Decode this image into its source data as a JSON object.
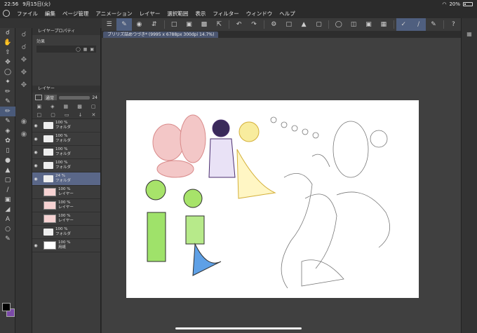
{
  "status": {
    "time": "22:56",
    "date": "9月15日(火)",
    "battery": "20%"
  },
  "menu": [
    "ファイル",
    "編集",
    "ページ管理",
    "アニメーション",
    "レイヤー",
    "選択範囲",
    "表示",
    "フィルター",
    "ウィンドウ",
    "ヘルプ"
  ],
  "tab": {
    "label": "プリリズ詰めつづき* (9995 x 6788px 300dpi 14.7%)"
  },
  "layer_property": {
    "title": "レイヤープロパティ",
    "effect_label": "効果"
  },
  "layer_panel": {
    "title": "レイヤー",
    "blend_mode": "通常",
    "opacity": "24",
    "layers": [
      {
        "pct": "100 %",
        "name": "フォルダ"
      },
      {
        "pct": "100 %",
        "name": "フォルダ"
      },
      {
        "pct": "100 %",
        "name": "フォルダ"
      },
      {
        "pct": "100 %",
        "name": "フォルダ"
      },
      {
        "pct": "24 %",
        "name": "フォルダ"
      },
      {
        "pct": "100 %",
        "name": "レイヤー"
      },
      {
        "pct": "100 %",
        "name": "レイヤー"
      },
      {
        "pct": "100 %",
        "name": "レイヤー"
      },
      {
        "pct": "100 %",
        "name": "フォルダ"
      },
      {
        "pct": "100 %",
        "name": "用紙"
      }
    ]
  },
  "colors": {
    "accent": "#4f5f7f",
    "main_color": "#000000",
    "sub_color": "#7b4aa8"
  }
}
